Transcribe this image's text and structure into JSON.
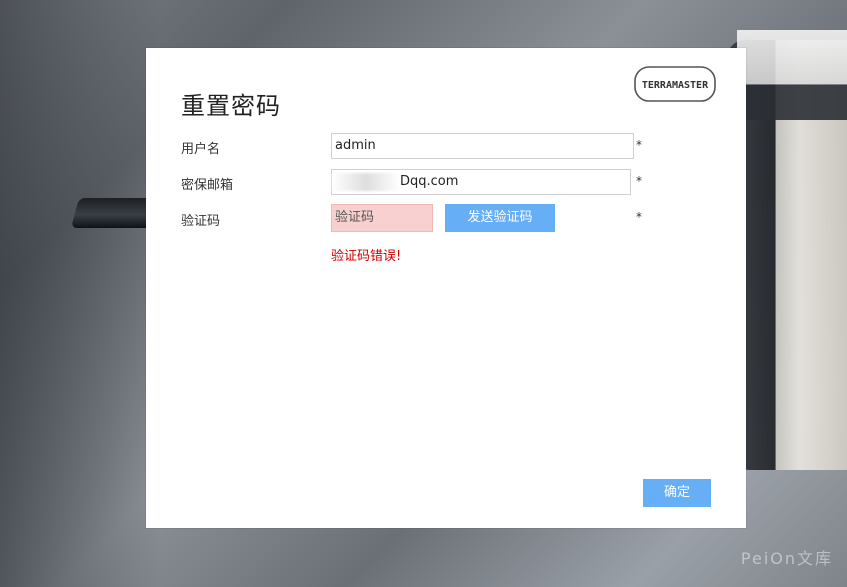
{
  "dialog": {
    "title": "重置密码",
    "logo_text": "TERRAMASTER",
    "username_label": "用户名",
    "username_value": "admin",
    "email_label": "密保邮箱",
    "email_value": "Dqq.com",
    "code_label": "验证码",
    "code_placeholder": "验证码",
    "send_code_button": "发送验证码",
    "required_mark": "*",
    "error_text": "验证码错误!",
    "confirm_button": "确定"
  },
  "watermark": "PeiOn文库",
  "colors": {
    "primary_button": "#66aef5",
    "error": "#d00000",
    "invalid_field_bg": "#f8d0d0"
  }
}
